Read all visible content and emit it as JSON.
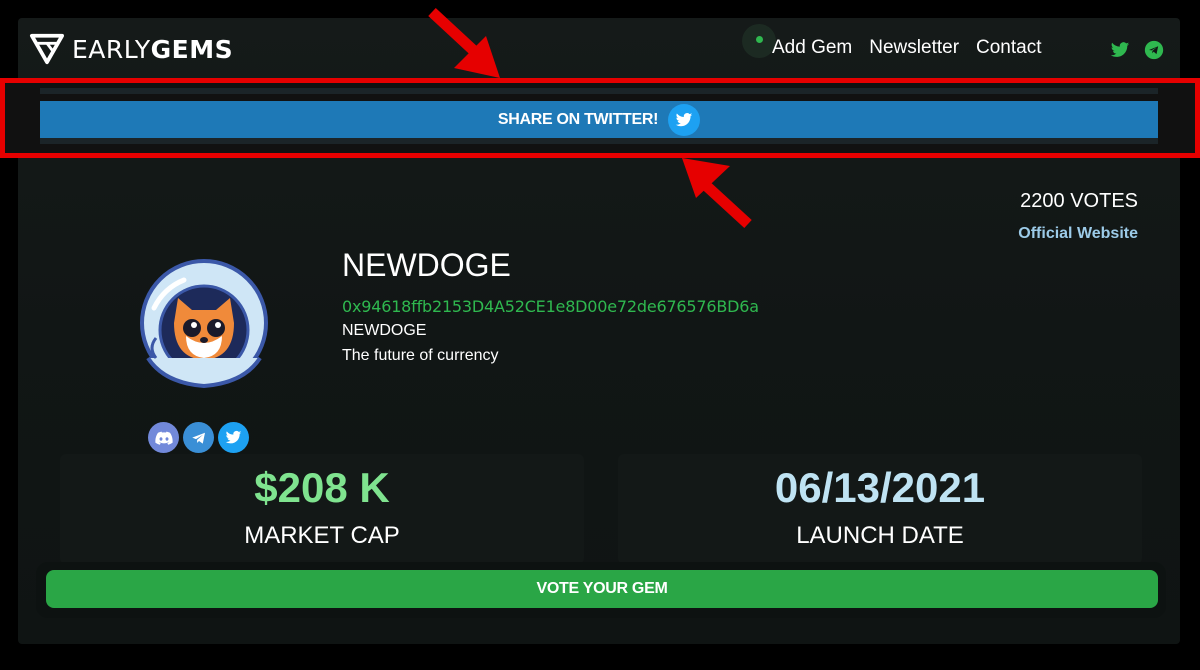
{
  "header": {
    "logo": {
      "early": "EARLY",
      "gems": "GEMS"
    },
    "nav": [
      "Add Gem",
      "Newsletter",
      "Contact"
    ],
    "social_icons": [
      "twitter-icon",
      "telegram-icon"
    ],
    "accent_green": "#2fb84f"
  },
  "share": {
    "label": "SHARE ON TWITTER!",
    "icon": "twitter-icon",
    "color": "#1e79b7"
  },
  "annotation": {
    "box_color": "#e60000",
    "arrows": [
      "arrow-pointing-down",
      "arrow-pointing-up"
    ]
  },
  "gem": {
    "votes": "2200 VOTES",
    "website_label": "Official Website",
    "name": "NEWDOGE",
    "address": "0x94618ffb2153D4A52CE1e8D00e72de676576BD6a",
    "ticker": "NEWDOGE",
    "description": "The future of currency",
    "socials": [
      "discord-icon",
      "telegram-icon",
      "twitter-icon"
    ],
    "market_cap": {
      "value": "$208 K",
      "label": "MARKET CAP",
      "color": "#7fe38f"
    },
    "launch_date": {
      "value": "06/13/2021",
      "label": "LAUNCH DATE",
      "color": "#bfe3f3"
    }
  },
  "vote_button": {
    "label": "VOTE YOUR GEM",
    "color": "#2aa646"
  }
}
